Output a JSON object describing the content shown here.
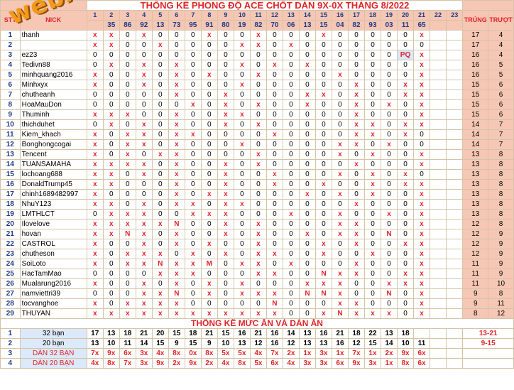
{
  "title": "THỐNG KÊ PHONG ĐỘ ACE CHỐT DÀN 9X-0X THÁNG 8/2022",
  "headers": {
    "stt": "STT",
    "nick": "NICK",
    "trung": "TRÚNG",
    "truot": "TRƯỢT"
  },
  "days": [
    "1",
    "2",
    "3",
    "4",
    "5",
    "6",
    "7",
    "8",
    "9",
    "10",
    "11",
    "12",
    "13",
    "14",
    "15",
    "16",
    "17",
    "18",
    "19",
    "20",
    "21",
    "22",
    "23"
  ],
  "results": [
    "",
    "35",
    "86",
    "92",
    "13",
    "73",
    "95",
    "91",
    "80",
    "19",
    "82",
    "70",
    "06",
    "13",
    "15",
    "04",
    "82",
    "93",
    "03",
    "11",
    "65",
    "",
    ""
  ],
  "rows": [
    {
      "stt": "1",
      "nick": "thanh",
      "vals": [
        "x",
        "x",
        "0",
        "x",
        "0",
        "0",
        "0",
        "x",
        "0",
        "0",
        "x",
        "0",
        "0",
        "0",
        "x",
        "0",
        "0",
        "0",
        "0",
        "0",
        "x",
        "",
        ""
      ],
      "trung": "17",
      "truot": "4"
    },
    {
      "stt": "2",
      "nick": "",
      "vals": [
        "x",
        "x",
        "0",
        "0",
        "x",
        "0",
        "0",
        "0",
        "0",
        "x",
        "x",
        "0",
        "x",
        "0",
        "0",
        "0",
        "0",
        "0",
        "0",
        "0",
        "0",
        "",
        ""
      ],
      "trung": "17",
      "truot": "4"
    },
    {
      "stt": "3",
      "nick": "ez23",
      "vals": [
        "0",
        "0",
        "0",
        "0",
        "0",
        "0",
        "0",
        "0",
        "0",
        "0",
        "0",
        "0",
        "0",
        "0",
        "0",
        "0",
        "0",
        "0",
        "0",
        "PQ",
        "x",
        "",
        ""
      ],
      "trung": "16",
      "truot": "4"
    },
    {
      "stt": "4",
      "nick": "Tedivn88",
      "vals": [
        "0",
        "x",
        "0",
        "x",
        "0",
        "x",
        "0",
        "0",
        "0",
        "x",
        "0",
        "x",
        "0",
        "x",
        "0",
        "0",
        "0",
        "0",
        "0",
        "0",
        "x",
        "",
        ""
      ],
      "trung": "16",
      "truot": "5"
    },
    {
      "stt": "5",
      "nick": "minhquang2016",
      "vals": [
        "x",
        "0",
        "0",
        "x",
        "0",
        "x",
        "0",
        "x",
        "0",
        "0",
        "x",
        "0",
        "0",
        "0",
        "0",
        "x",
        "0",
        "0",
        "0",
        "0",
        "x",
        "",
        ""
      ],
      "trung": "16",
      "truot": "5"
    },
    {
      "stt": "6",
      "nick": "Minhxyx",
      "vals": [
        "x",
        "0",
        "0",
        "x",
        "0",
        "x",
        "0",
        "0",
        "0",
        "x",
        "0",
        "0",
        "0",
        "0",
        "0",
        "0",
        "x",
        "0",
        "0",
        "x",
        "x",
        "",
        ""
      ],
      "trung": "15",
      "truot": "6"
    },
    {
      "stt": "7",
      "nick": "chutheanh",
      "vals": [
        "0",
        "0",
        "0",
        "0",
        "0",
        "x",
        "0",
        "0",
        "x",
        "0",
        "0",
        "0",
        "0",
        "x",
        "x",
        "0",
        "x",
        "0",
        "0",
        "x",
        "x",
        "",
        ""
      ],
      "trung": "15",
      "truot": "6"
    },
    {
      "stt": "8",
      "nick": "HoaMauDon",
      "vals": [
        "0",
        "0",
        "0",
        "0",
        "0",
        "0",
        "x",
        "0",
        "x",
        "0",
        "x",
        "0",
        "0",
        "x",
        "0",
        "0",
        "x",
        "0",
        "x",
        "0",
        "x",
        "",
        ""
      ],
      "trung": "15",
      "truot": "6"
    },
    {
      "stt": "9",
      "nick": "Thuminh",
      "vals": [
        "x",
        "x",
        "x",
        "0",
        "0",
        "x",
        "0",
        "0",
        "x",
        "x",
        "0",
        "0",
        "0",
        "0",
        "0",
        "0",
        "x",
        "0",
        "0",
        "0",
        "x",
        "",
        ""
      ],
      "trung": "15",
      "truot": "6"
    },
    {
      "stt": "10",
      "nick": "thichduhet",
      "vals": [
        "0",
        "x",
        "0",
        "x",
        "0",
        "x",
        "0",
        "0",
        "x",
        "0",
        "x",
        "0",
        "0",
        "0",
        "0",
        "0",
        "x",
        "x",
        "0",
        "x",
        "x",
        "",
        ""
      ],
      "trung": "14",
      "truot": "7"
    },
    {
      "stt": "11",
      "nick": "Kiem_khach",
      "vals": [
        "x",
        "0",
        "x",
        "x",
        "0",
        "x",
        "x",
        "0",
        "0",
        "0",
        "0",
        "x",
        "0",
        "0",
        "0",
        "0",
        "x",
        "x",
        "0",
        "x",
        "0",
        "",
        ""
      ],
      "trung": "14",
      "truot": "7"
    },
    {
      "stt": "12",
      "nick": "Bonghongcogai",
      "vals": [
        "x",
        "0",
        "x",
        "x",
        "0",
        "x",
        "0",
        "0",
        "0",
        "x",
        "0",
        "0",
        "0",
        "0",
        "0",
        "x",
        "x",
        "0",
        "x",
        "0",
        "0",
        "",
        ""
      ],
      "trung": "14",
      "truot": "7"
    },
    {
      "stt": "13",
      "nick": "Tencent",
      "vals": [
        "x",
        "0",
        "x",
        "0",
        "x",
        "x",
        "0",
        "0",
        "0",
        "0",
        "x",
        "0",
        "0",
        "0",
        "0",
        "x",
        "0",
        "x",
        "0",
        "0",
        "x",
        "",
        ""
      ],
      "trung": "13",
      "truot": "8"
    },
    {
      "stt": "14",
      "nick": "TUANSAMAHA",
      "vals": [
        "x",
        "x",
        "x",
        "x",
        "0",
        "x",
        "0",
        "0",
        "x",
        "0",
        "x",
        "0",
        "0",
        "0",
        "0",
        "0",
        "x",
        "0",
        "0",
        "0",
        "x",
        "",
        ""
      ],
      "trung": "13",
      "truot": "8"
    },
    {
      "stt": "15",
      "nick": "lochoang688",
      "vals": [
        "x",
        "x",
        "0",
        "x",
        "0",
        "x",
        "0",
        "0",
        "x",
        "0",
        "0",
        "x",
        "0",
        "0",
        "0",
        "x",
        "0",
        "x",
        "0",
        "x",
        "0",
        "",
        ""
      ],
      "trung": "13",
      "truot": "8"
    },
    {
      "stt": "16",
      "nick": "DonaldTrump45",
      "vals": [
        "x",
        "x",
        "0",
        "0",
        "0",
        "x",
        "0",
        "0",
        "x",
        "0",
        "0",
        "x",
        "0",
        "0",
        "x",
        "0",
        "0",
        "x",
        "0",
        "x",
        "x",
        "",
        ""
      ],
      "trung": "13",
      "truot": "8"
    },
    {
      "stt": "17",
      "nick": "chinh1689482997",
      "vals": [
        "x",
        "0",
        "0",
        "0",
        "0",
        "x",
        "0",
        "x",
        "x",
        "0",
        "0",
        "0",
        "0",
        "x",
        "0",
        "x",
        "0",
        "x",
        "0",
        "0",
        "x",
        "",
        ""
      ],
      "trung": "13",
      "truot": "8"
    },
    {
      "stt": "18",
      "nick": "NhuY123",
      "vals": [
        "x",
        "x",
        "0",
        "x",
        "0",
        "x",
        "x",
        "0",
        "x",
        "x",
        "0",
        "0",
        "0",
        "0",
        "0",
        "0",
        "x",
        "0",
        "0",
        "0",
        "x",
        "",
        ""
      ],
      "trung": "13",
      "truot": "8"
    },
    {
      "stt": "19",
      "nick": "LMTHLCT",
      "vals": [
        "0",
        "x",
        "x",
        "x",
        "0",
        "0",
        "x",
        "x",
        "x",
        "0",
        "0",
        "0",
        "x",
        "0",
        "0",
        "x",
        "0",
        "0",
        "x",
        "0",
        "x",
        "",
        ""
      ],
      "trung": "13",
      "truot": "8"
    },
    {
      "stt": "20",
      "nick": "Ilovelove",
      "vals": [
        "x",
        "x",
        "x",
        "x",
        "x",
        "N",
        "0",
        "0",
        "x",
        "0",
        "x",
        "0",
        "0",
        "0",
        "0",
        "x",
        "x",
        "0",
        "0",
        "0",
        "x",
        "",
        ""
      ],
      "trung": "12",
      "truot": "8"
    },
    {
      "stt": "21",
      "nick": "hovan",
      "vals": [
        "x",
        "x",
        "N",
        "x",
        "0",
        "x",
        "0",
        "0",
        "x",
        "0",
        "x",
        "0",
        "0",
        "x",
        "0",
        "x",
        "x",
        "0",
        "N",
        "0",
        "x",
        "",
        ""
      ],
      "trung": "12",
      "truot": "9"
    },
    {
      "stt": "22",
      "nick": "CASTROL",
      "vals": [
        "x",
        "0",
        "0",
        "x",
        "0",
        "x",
        "0",
        "x",
        "0",
        "0",
        "x",
        "0",
        "0",
        "0",
        "x",
        "0",
        "x",
        "0",
        "0",
        "x",
        "x",
        "",
        ""
      ],
      "trung": "12",
      "truot": "9"
    },
    {
      "stt": "23",
      "nick": "chutheson",
      "vals": [
        "x",
        "0",
        "x",
        "x",
        "x",
        "0",
        "x",
        "0",
        "x",
        "0",
        "x",
        "x",
        "0",
        "0",
        "x",
        "0",
        "0",
        "x",
        "0",
        "0",
        "x",
        "",
        ""
      ],
      "trung": "12",
      "truot": "9"
    },
    {
      "stt": "24",
      "nick": "SoiLoto",
      "vals": [
        "x",
        "0",
        "x",
        "x",
        "N",
        "x",
        "x",
        "M",
        "0",
        "x",
        "x",
        "0",
        "x",
        "0",
        "0",
        "0",
        "x",
        "0",
        "0",
        "0",
        "x",
        "",
        ""
      ],
      "trung": "11",
      "truot": "9"
    },
    {
      "stt": "25",
      "nick": "HacTamMao",
      "vals": [
        "0",
        "0",
        "0",
        "0",
        "x",
        "x",
        "x",
        "0",
        "0",
        "0",
        "x",
        "x",
        "0",
        "0",
        "N",
        "x",
        "x",
        "0",
        "0",
        "x",
        "x",
        "",
        ""
      ],
      "trung": "11",
      "truot": "9"
    },
    {
      "stt": "26",
      "nick": "Mualarung2016",
      "vals": [
        "x",
        "0",
        "0",
        "x",
        "0",
        "x",
        "0",
        "x",
        "0",
        "x",
        "0",
        "0",
        "0",
        "x",
        "x",
        "x",
        "0",
        "0",
        "x",
        "x",
        "x",
        "",
        ""
      ],
      "trung": "11",
      "truot": "10"
    },
    {
      "stt": "27",
      "nick": "namviettri39",
      "vals": [
        "0",
        "0",
        "0",
        "x",
        "x",
        "N",
        "0",
        "x",
        "0",
        "x",
        "x",
        "x",
        "0",
        "N",
        "N",
        "x",
        "0",
        "0",
        "N",
        "0",
        "x",
        "",
        ""
      ],
      "trung": "9",
      "truot": "8"
    },
    {
      "stt": "28",
      "nick": "tocvanghoe",
      "vals": [
        "x",
        "0",
        "x",
        "x",
        "x",
        "x",
        "0",
        "0",
        "0",
        "0",
        "0",
        "N",
        "0",
        "0",
        "0",
        "x",
        "x",
        "0",
        "0",
        "0",
        "x",
        "",
        ""
      ],
      "trung": "9",
      "truot": "11"
    },
    {
      "stt": "29",
      "nick": "THUYAN",
      "vals": [
        "x",
        "x",
        "x",
        "x",
        "x",
        "x",
        "x",
        "x",
        "x",
        "x",
        "x",
        "x",
        "0",
        "0",
        "x",
        "N",
        "x",
        "x",
        "x",
        "0",
        "x",
        "",
        ""
      ],
      "trung": "8",
      "truot": "12"
    }
  ],
  "summary": {
    "title": "THỐNG KÊ MỨC ĂN VÀ DÀN ĂN",
    "rows": [
      {
        "stt": "1",
        "label": "32 bạn",
        "vals": [
          "17",
          "13",
          "18",
          "21",
          "20",
          "15",
          "18",
          "21",
          "15",
          "16",
          "21",
          "16",
          "14",
          "13",
          "16",
          "21",
          "18",
          "22",
          "13",
          "18",
          "",
          ""
        ],
        "range": "13-21"
      },
      {
        "stt": "2",
        "label": "20 bạn",
        "vals": [
          "13",
          "10",
          "11",
          "14",
          "15",
          "9",
          "15",
          "9",
          "10",
          "13",
          "12",
          "16",
          "12",
          "13",
          "13",
          "16",
          "12",
          "15",
          "14",
          "10",
          "11",
          ""
        ],
        "range": "9-15"
      },
      {
        "stt": "3",
        "label": "DÀN 32 BẠN",
        "vals": [
          "7x",
          "9x",
          "6x",
          "3x",
          "4x",
          "8x",
          "0x",
          "8x",
          "5x",
          "5x",
          "4x",
          "7x",
          "2x",
          "1x",
          "3x",
          "1x",
          "7x",
          "1x",
          "2x",
          "9x",
          "6x",
          ""
        ],
        "range": ""
      },
      {
        "stt": "4",
        "label": "DÀN 20 BẠN",
        "vals": [
          "4x",
          "8x",
          "7x",
          "3x",
          "9x",
          "2x",
          "9x",
          "2x",
          "4x",
          "8x",
          "5x",
          "6x",
          "4x",
          "3x",
          "3x",
          "6x",
          "9x",
          "3x",
          "1x",
          "8x",
          "6x",
          ""
        ],
        "range": ""
      }
    ]
  },
  "watermark": "webxoso.net",
  "colors": {
    "accent": "#e0232a",
    "header_bg": "#f6c7b4",
    "label_bg": "#dbe9fb",
    "watermark": "#f29a1a"
  }
}
